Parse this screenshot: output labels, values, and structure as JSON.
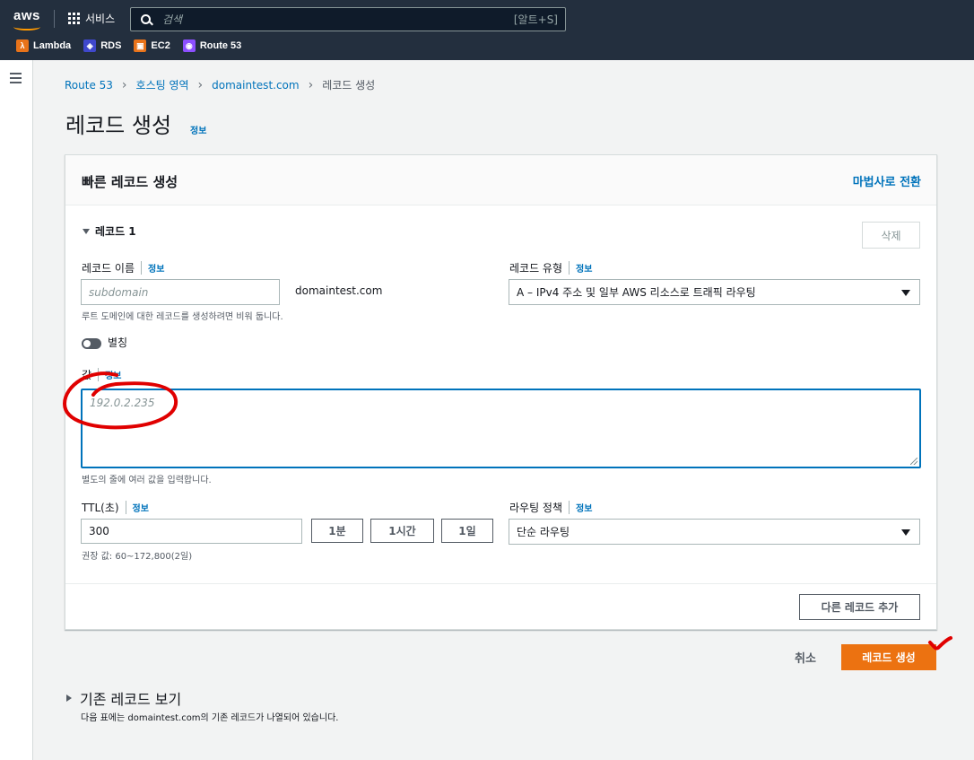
{
  "topbar": {
    "logo": "aws",
    "services_label": "서비스",
    "search_placeholder": "검색",
    "search_shortcut": "[알트+S]",
    "favorites": [
      {
        "label": "Lambda",
        "icon": "lambda-icon",
        "color": "#e8731a"
      },
      {
        "label": "RDS",
        "icon": "rds-icon",
        "color": "#3f48cc"
      },
      {
        "label": "EC2",
        "icon": "ec2-icon",
        "color": "#e8731a"
      },
      {
        "label": "Route 53",
        "icon": "route53-icon",
        "color": "#8c4fff"
      }
    ]
  },
  "breadcrumb": {
    "items": [
      "Route 53",
      "호스팅 영역",
      "domaintest.com"
    ],
    "current": "레코드 생성"
  },
  "page": {
    "title": "레코드 생성",
    "info": "정보"
  },
  "panel": {
    "title": "빠른 레코드 생성",
    "wizard_link": "마법사로 전환",
    "record_toggle": "레코드 1",
    "delete_label": "삭제",
    "record_name": {
      "label": "레코드 이름",
      "info": "정보",
      "placeholder": "subdomain",
      "suffix": "domaintest.com",
      "hint": "루트 도메인에 대한 레코드를 생성하려면 비워 둡니다."
    },
    "record_type": {
      "label": "레코드 유형",
      "info": "정보",
      "value": "A – IPv4 주소 및 일부 AWS 리소스로 트래픽 라우팅"
    },
    "alias": {
      "label": "별칭",
      "enabled": false
    },
    "value": {
      "label": "값",
      "info": "정보",
      "placeholder": "192.0.2.235",
      "hint": "별도의 줄에 여러 값을 입력합니다."
    },
    "ttl": {
      "label": "TTL(초)",
      "info": "정보",
      "value": "300",
      "buttons": [
        "1분",
        "1시간",
        "1일"
      ],
      "hint": "권장 값: 60~172,800(2일)"
    },
    "routing": {
      "label": "라우팅 정책",
      "info": "정보",
      "value": "단순 라우팅"
    },
    "add_record_label": "다른 레코드 추가"
  },
  "actions": {
    "cancel": "취소",
    "create": "레코드 생성"
  },
  "existing": {
    "title": "기존 레코드 보기",
    "desc": "다음 표에는 domaintest.com의 기존 레코드가 나열되어 있습니다."
  },
  "colors": {
    "accent": "#0073bb",
    "primary_button": "#ec7211",
    "annotation": "#e00000"
  }
}
